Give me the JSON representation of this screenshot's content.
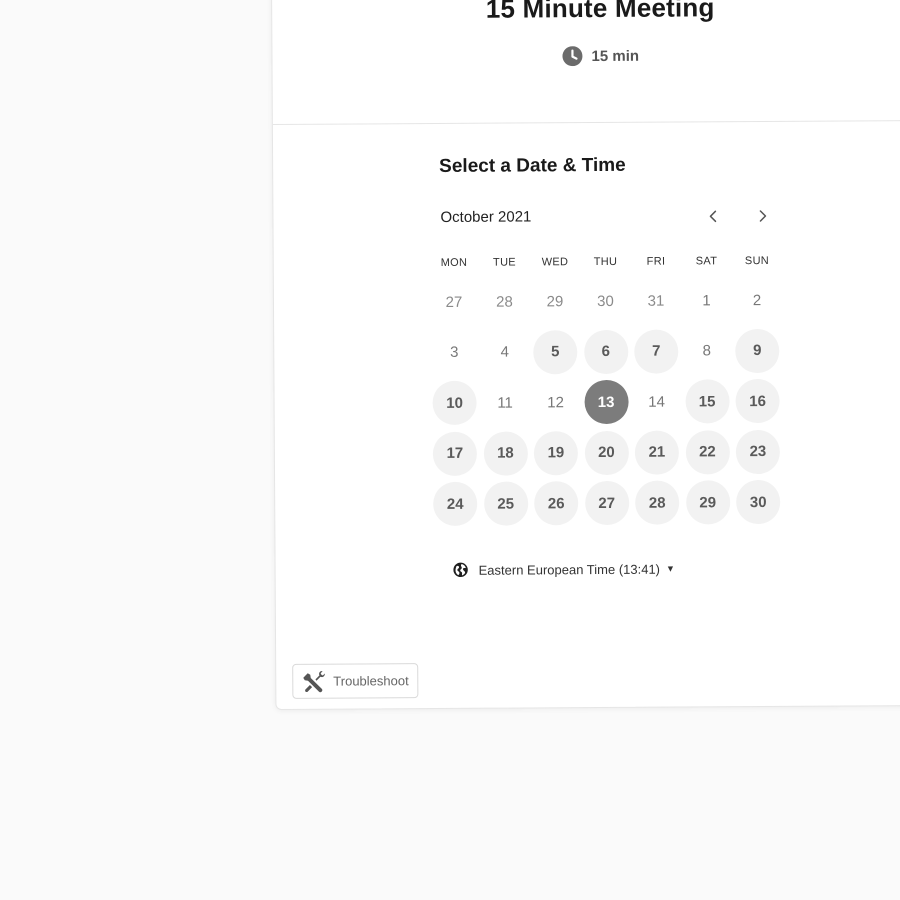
{
  "event": {
    "title": "15 Minute Meeting",
    "duration": "15 min"
  },
  "picker": {
    "title": "Select a Date & Time",
    "month": "October 2021",
    "weekdays": [
      "MON",
      "TUE",
      "WED",
      "THU",
      "FRI",
      "SAT",
      "SUN"
    ],
    "days": [
      {
        "label": "27",
        "state": "muted"
      },
      {
        "label": "28",
        "state": "muted"
      },
      {
        "label": "29",
        "state": "muted"
      },
      {
        "label": "30",
        "state": "muted"
      },
      {
        "label": "31",
        "state": "muted"
      },
      {
        "label": "1",
        "state": "unavailable"
      },
      {
        "label": "2",
        "state": "unavailable"
      },
      {
        "label": "3",
        "state": "unavailable"
      },
      {
        "label": "4",
        "state": "unavailable"
      },
      {
        "label": "5",
        "state": "available"
      },
      {
        "label": "6",
        "state": "available"
      },
      {
        "label": "7",
        "state": "available"
      },
      {
        "label": "8",
        "state": "unavailable"
      },
      {
        "label": "9",
        "state": "available"
      },
      {
        "label": "10",
        "state": "available"
      },
      {
        "label": "11",
        "state": "unavailable"
      },
      {
        "label": "12",
        "state": "unavailable"
      },
      {
        "label": "13",
        "state": "selected"
      },
      {
        "label": "14",
        "state": "unavailable"
      },
      {
        "label": "15",
        "state": "available"
      },
      {
        "label": "16",
        "state": "available"
      },
      {
        "label": "17",
        "state": "available"
      },
      {
        "label": "18",
        "state": "available"
      },
      {
        "label": "19",
        "state": "available"
      },
      {
        "label": "20",
        "state": "available"
      },
      {
        "label": "21",
        "state": "available"
      },
      {
        "label": "22",
        "state": "available"
      },
      {
        "label": "23",
        "state": "available"
      },
      {
        "label": "24",
        "state": "available"
      },
      {
        "label": "25",
        "state": "available"
      },
      {
        "label": "26",
        "state": "available"
      },
      {
        "label": "27",
        "state": "available"
      },
      {
        "label": "28",
        "state": "available"
      },
      {
        "label": "29",
        "state": "available"
      },
      {
        "label": "30",
        "state": "available"
      }
    ],
    "timezone": "Eastern European Time (13:41)"
  },
  "footer": {
    "troubleshoot_label": "Troubleshoot"
  },
  "icons": {
    "duration": "clock-icon",
    "prev": "chevron-left-icon",
    "next": "chevron-right-icon",
    "timezone": "globe-icon",
    "troubleshoot": "wrench-icon"
  },
  "colors": {
    "selected_day": "#7c7c7c",
    "available_day": "#f2f2f2",
    "page_background": "#fafafa"
  }
}
